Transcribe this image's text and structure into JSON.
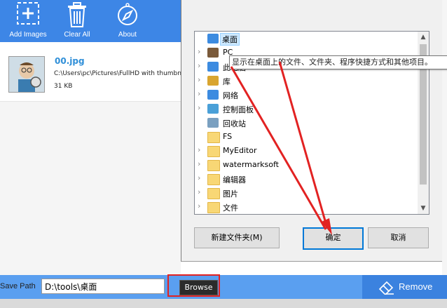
{
  "toolbar": {
    "add_label": "Add Images",
    "clear_label": "Clear All",
    "about_label": "About"
  },
  "image_list": [
    {
      "name": "00.jpg",
      "path": "C:\\Users\\pc\\Pictures\\FullHD with thumbnail",
      "size": "31 KB"
    }
  ],
  "folder_dialog": {
    "tree": [
      {
        "label": "桌面",
        "icon": "desktop-icon",
        "expandable": false,
        "selected": true
      },
      {
        "label": "PC",
        "icon": "user-icon",
        "expandable": true
      },
      {
        "label": "此电脑",
        "icon": "computer-icon",
        "expandable": true
      },
      {
        "label": "库",
        "icon": "library-icon",
        "expandable": true
      },
      {
        "label": "网络",
        "icon": "network-icon",
        "expandable": true
      },
      {
        "label": "控制面板",
        "icon": "control-panel-icon",
        "expandable": true
      },
      {
        "label": "回收站",
        "icon": "recycle-bin-icon",
        "expandable": false
      },
      {
        "label": "FS",
        "icon": "folder-icon",
        "expandable": false
      },
      {
        "label": "MyEditor",
        "icon": "folder-icon",
        "expandable": true
      },
      {
        "label": "watermarksoft",
        "icon": "folder-icon",
        "expandable": true
      },
      {
        "label": "编辑器",
        "icon": "folder-icon",
        "expandable": true
      },
      {
        "label": "图片",
        "icon": "folder-icon",
        "expandable": true
      },
      {
        "label": "文件",
        "icon": "folder-icon",
        "expandable": true
      }
    ],
    "tooltip": "显示在桌面上的文件、文件夹、程序快捷方式和其他项目。",
    "new_folder_label": "新建文件夹(M)",
    "ok_label": "确定",
    "cancel_label": "取消"
  },
  "bottom_bar": {
    "save_path_label": "Save Path",
    "save_path_value": "D:\\tools\\桌面",
    "browse_label": "Browse",
    "remove_label": "Remove"
  },
  "colors": {
    "toolbar": "#3d86e6",
    "bottom_bar": "#5a9ff0",
    "remove_button": "#3b82df",
    "annotation_red": "#e22222",
    "link_blue": "#2f8fd8"
  }
}
